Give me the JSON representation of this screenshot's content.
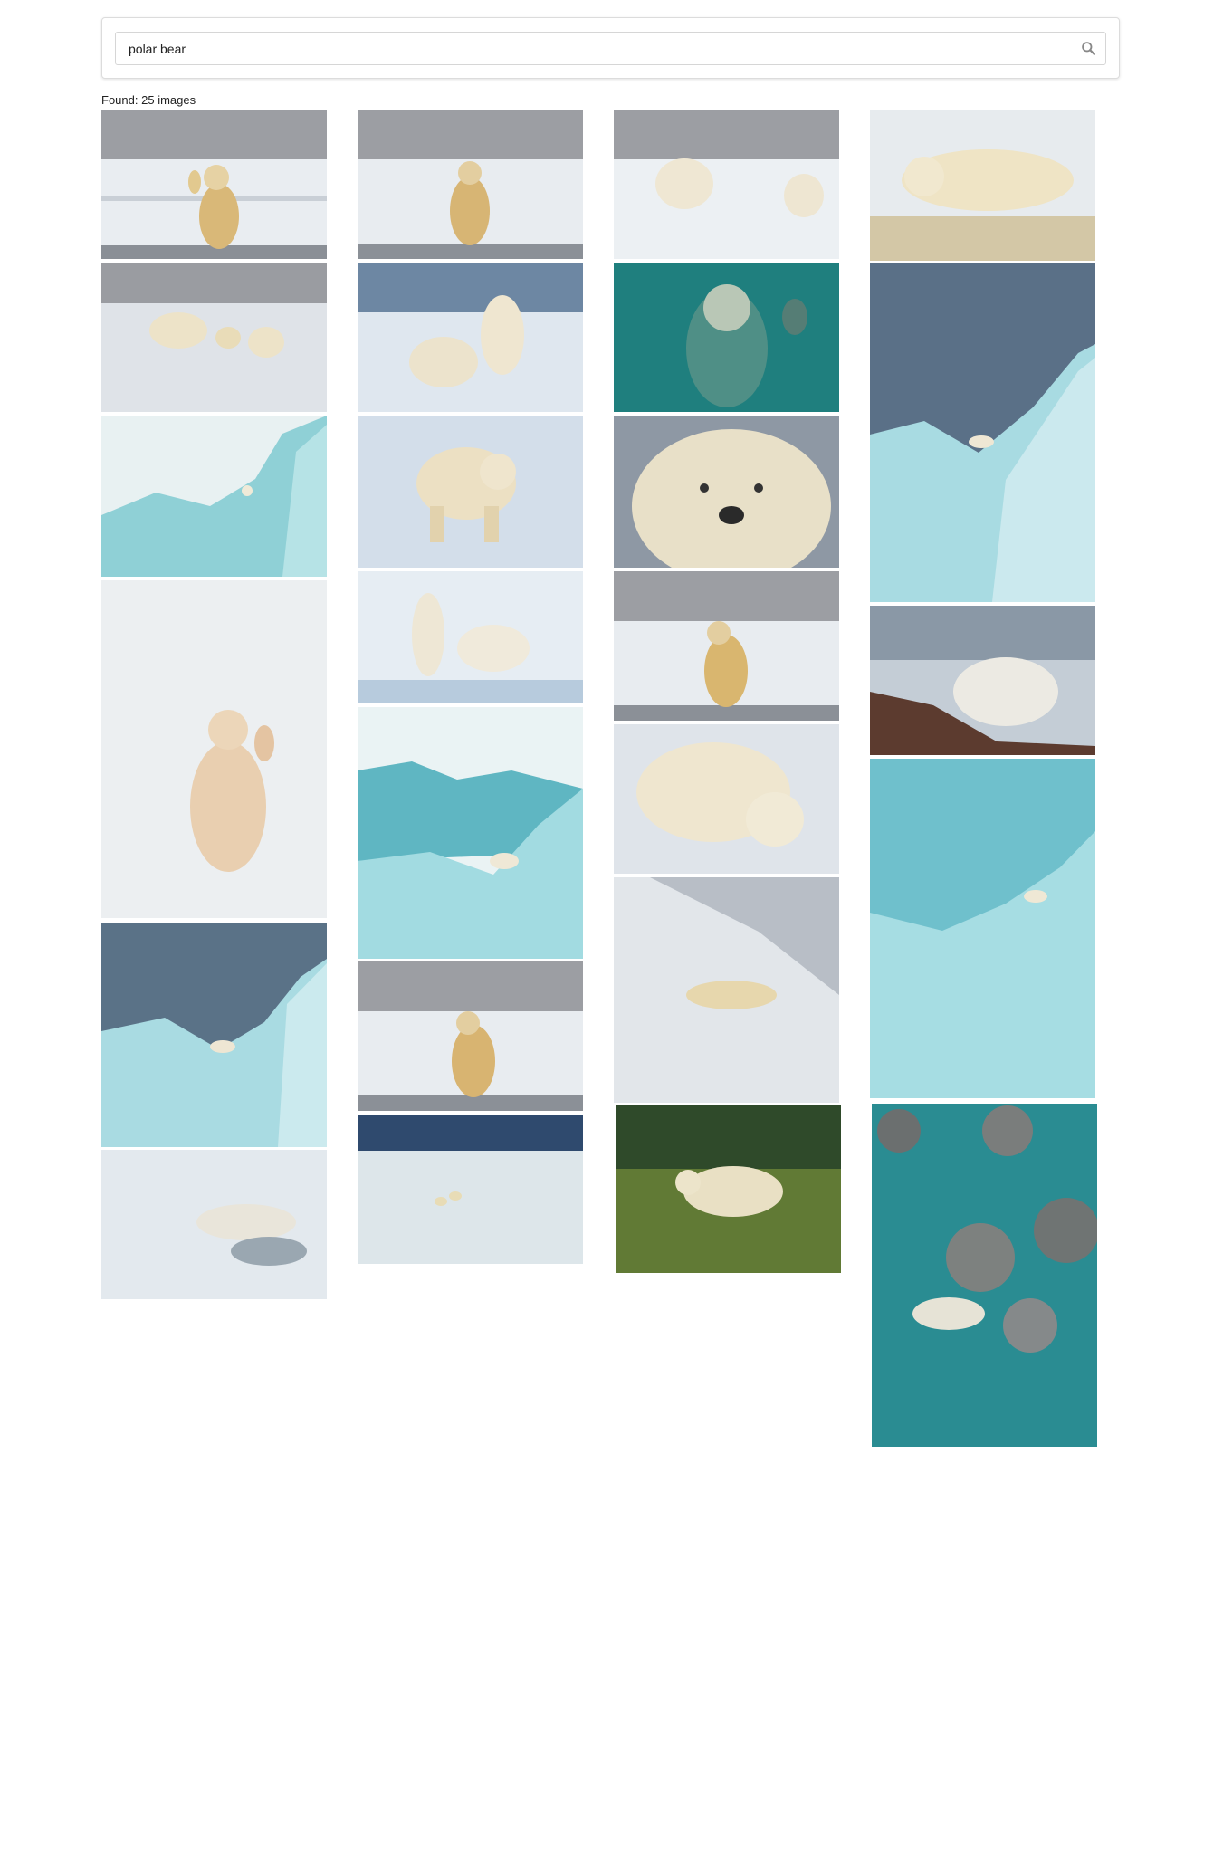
{
  "search": {
    "value": "polar bear",
    "icon": "search-icon"
  },
  "results": {
    "found_label": "Found:",
    "count": 25,
    "unit": "images"
  },
  "colors": {
    "sky_grey": "#9a9ca1",
    "snow": "#eef1f4",
    "ice_blue": "#7fcad4",
    "water_teal": "#1f8a8c",
    "bear_cream": "#e8d9b4",
    "bear_gold": "#d8b56e"
  }
}
